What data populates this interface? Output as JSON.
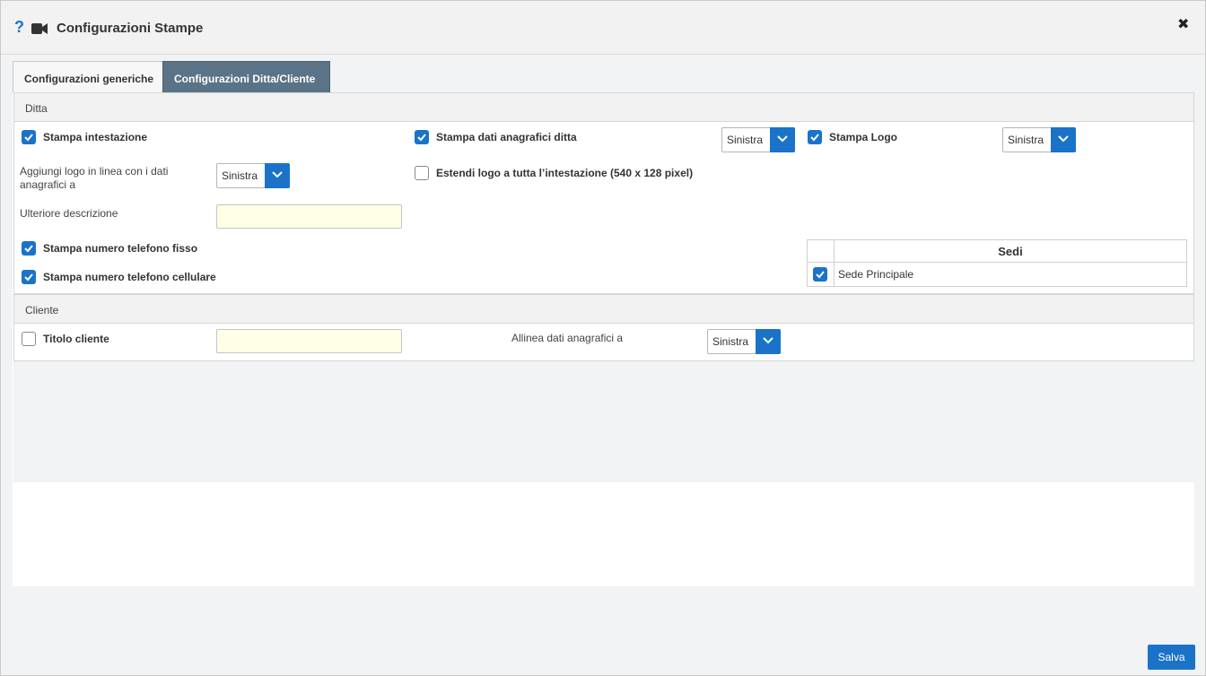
{
  "window": {
    "title": "Configurazioni Stampe",
    "help_icon": "?"
  },
  "tabs": [
    {
      "label": "Configurazioni generiche",
      "active": false
    },
    {
      "label": "Configurazioni Ditta/Cliente",
      "active": true
    }
  ],
  "ditta": {
    "header": "Ditta",
    "stampa_intestazione": {
      "label": "Stampa intestazione",
      "checked": true
    },
    "stampa_dati_anagrafici": {
      "label": "Stampa dati anagrafici ditta",
      "checked": true,
      "align": "Sinistra"
    },
    "stampa_logo": {
      "label": "Stampa Logo",
      "checked": true,
      "align": "Sinistra"
    },
    "logo_in_linea": {
      "label": "Aggiungi logo in linea con i dati anagrafici a",
      "value": "Sinistra"
    },
    "estendi_logo": {
      "label": "Estendi logo a tutta l’intestazione (540 x 128 pixel)",
      "checked": false
    },
    "ulteriore_descrizione": {
      "label": "Ulteriore descrizione",
      "value": ""
    },
    "telefono_fisso": {
      "label": "Stampa numero telefono fisso",
      "checked": true
    },
    "telefono_cellulare": {
      "label": "Stampa numero telefono cellulare",
      "checked": true
    },
    "sedi": {
      "header": "Sedi",
      "rows": [
        {
          "name": "Sede Principale",
          "checked": true
        }
      ]
    }
  },
  "cliente": {
    "header": "Cliente",
    "titolo_cliente": {
      "label": "Titolo cliente",
      "checked": false,
      "value": ""
    },
    "allinea": {
      "label": "Allinea dati anagrafici a",
      "value": "Sinistra"
    }
  },
  "footer": {
    "save_label": "Salva"
  },
  "colors": {
    "accent": "#1a73c9",
    "active_tab": "#5b7386",
    "input_bg": "#ffffe6"
  }
}
